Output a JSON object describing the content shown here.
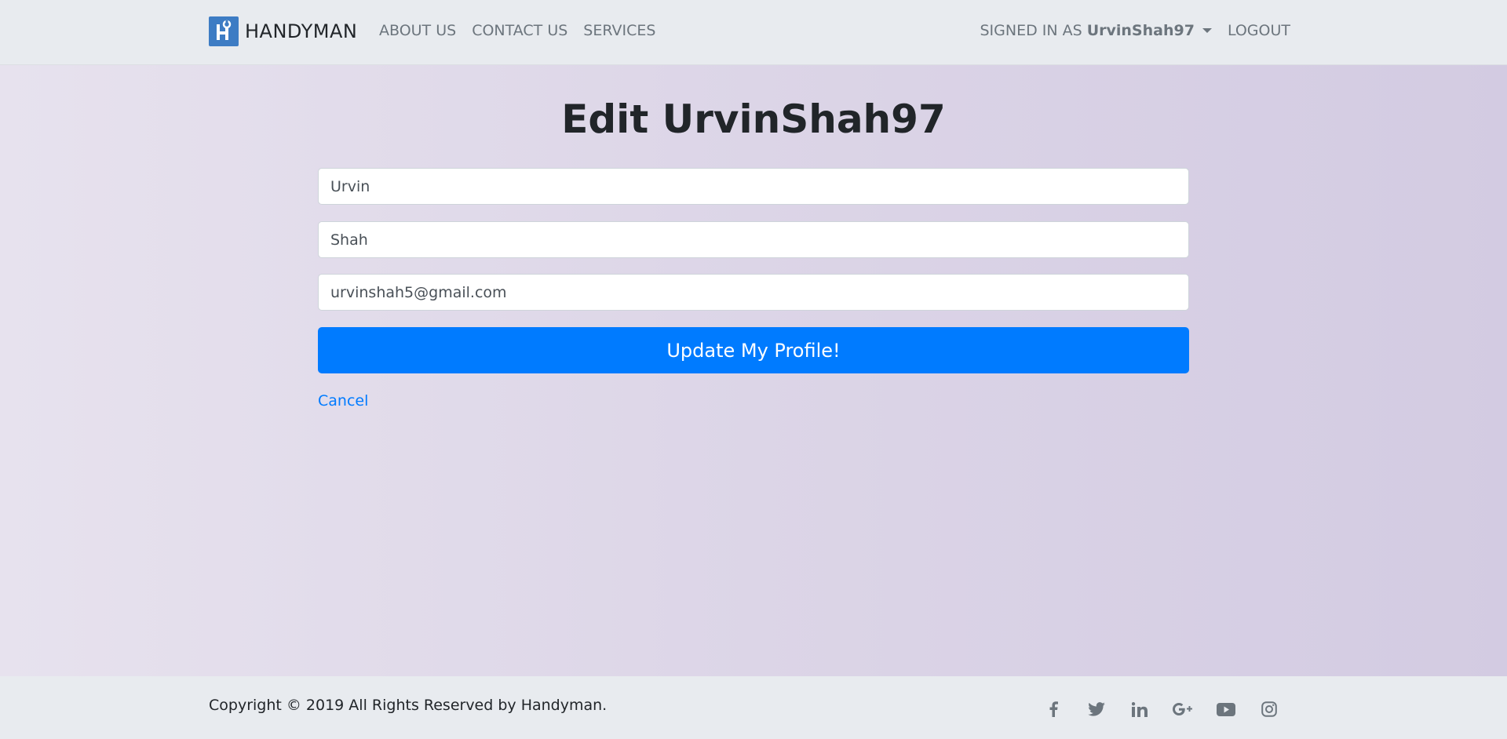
{
  "nav": {
    "brand": "HANDYMAN",
    "links": [
      "ABOUT US",
      "CONTACT US",
      "SERVICES"
    ],
    "signed_in_prefix": "SIGNED IN AS",
    "username": "UrvinShah97",
    "logout": "LOGOUT"
  },
  "main": {
    "title": "Edit UrvinShah97",
    "first_name": "Urvin",
    "last_name": "Shah",
    "email": "urvinshah5@gmail.com",
    "submit_label": "Update My Profile!",
    "cancel_label": "Cancel"
  },
  "footer": {
    "copyright": "Copyright © 2019 All Rights Reserved by Handyman.",
    "social_icons": [
      "facebook-icon",
      "twitter-icon",
      "linkedin-icon",
      "google-plus-icon",
      "youtube-icon",
      "instagram-icon"
    ]
  },
  "colors": {
    "primary": "#007bff",
    "navbar_bg": "#e8ebef",
    "logo_bg": "#3d7cc4",
    "icon_gray": "#6c757d"
  }
}
